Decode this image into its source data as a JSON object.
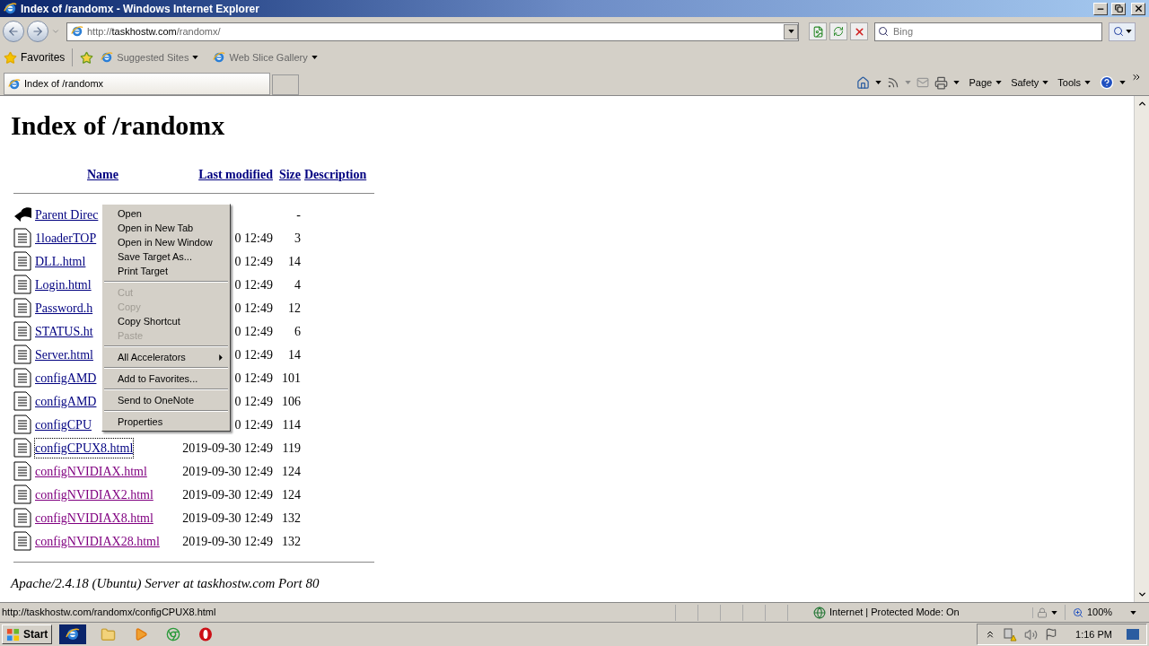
{
  "window": {
    "title": "Index of /randomx - Windows Internet Explorer"
  },
  "address_bar": {
    "url_prefix": "http://",
    "url_host": "taskhostw.com",
    "url_path": "/randomx/"
  },
  "search": {
    "placeholder": "Bing"
  },
  "favorites_bar": {
    "favorites": "Favorites",
    "items": [
      {
        "label": "Suggested Sites"
      },
      {
        "label": "Web Slice Gallery"
      }
    ]
  },
  "tabs": [
    {
      "label": "Index of /randomx",
      "selected": true
    }
  ],
  "command_bar": [
    "Page",
    "Safety",
    "Tools"
  ],
  "page": {
    "heading": "Index of /randomx",
    "columns": [
      "Name",
      "Last modified",
      "Size",
      "Description"
    ],
    "rows": [
      {
        "kind": "parent",
        "name": "Parent Direc",
        "date": "",
        "size": "-",
        "visited": false
      },
      {
        "kind": "file",
        "name": "1loaderTOP",
        "date": "0 12:49",
        "size": "3",
        "visited": false
      },
      {
        "kind": "file",
        "name": "DLL.html",
        "date": "0 12:49",
        "size": "14",
        "visited": false
      },
      {
        "kind": "file",
        "name": "Login.html",
        "date": "0 12:49",
        "size": "4",
        "visited": false
      },
      {
        "kind": "file",
        "name": "Password.h",
        "date": "0 12:49",
        "size": "12",
        "visited": false
      },
      {
        "kind": "file",
        "name": "STATUS.ht",
        "date": "0 12:49",
        "size": "6",
        "visited": false
      },
      {
        "kind": "file",
        "name": "Server.html",
        "date": "0 12:49",
        "size": "14",
        "visited": false
      },
      {
        "kind": "file",
        "name": "configAMD",
        "date": "0 12:49",
        "size": "101",
        "visited": false
      },
      {
        "kind": "file",
        "name": "configAMD",
        "date": "0 12:49",
        "size": "106",
        "visited": false
      },
      {
        "kind": "file",
        "name": "configCPU",
        "date": "0 12:49",
        "size": "114",
        "visited": false
      },
      {
        "kind": "file",
        "name": "configCPUX8.html",
        "date": "2019-09-30 12:49",
        "size": "119",
        "visited": false
      },
      {
        "kind": "file",
        "name": "configNVIDIAX.html",
        "date": "2019-09-30 12:49",
        "size": "124",
        "visited": true
      },
      {
        "kind": "file",
        "name": "configNVIDIAX2.html",
        "date": "2019-09-30 12:49",
        "size": "124",
        "visited": true
      },
      {
        "kind": "file",
        "name": "configNVIDIAX8.html",
        "date": "2019-09-30 12:49",
        "size": "132",
        "visited": true
      },
      {
        "kind": "file",
        "name": "configNVIDIAX28.html",
        "date": "2019-09-30 12:49",
        "size": "132",
        "visited": true
      }
    ],
    "footer": "Apache/2.4.18 (Ubuntu) Server at taskhostw.com Port 80"
  },
  "context_menu": {
    "groups": [
      [
        {
          "label": "Open",
          "disabled": false
        },
        {
          "label": "Open in New Tab",
          "disabled": false
        },
        {
          "label": "Open in New Window",
          "disabled": false
        },
        {
          "label": "Save Target As...",
          "disabled": false
        },
        {
          "label": "Print Target",
          "disabled": false
        }
      ],
      [
        {
          "label": "Cut",
          "disabled": true
        },
        {
          "label": "Copy",
          "disabled": true
        },
        {
          "label": "Copy Shortcut",
          "disabled": false
        },
        {
          "label": "Paste",
          "disabled": true
        }
      ],
      [
        {
          "label": "All Accelerators",
          "disabled": false,
          "submenu": true
        }
      ],
      [
        {
          "label": "Add to Favorites...",
          "disabled": false
        }
      ],
      [
        {
          "label": "Send to OneNote",
          "disabled": false
        }
      ],
      [
        {
          "label": "Properties",
          "disabled": false
        }
      ]
    ]
  },
  "status_bar": {
    "url": "http://taskhostw.com/randomx/configCPUX8.html",
    "zone": "Internet | Protected Mode: On",
    "zoom": "100%"
  },
  "taskbar": {
    "start": "Start",
    "clock": "1:16 PM"
  }
}
